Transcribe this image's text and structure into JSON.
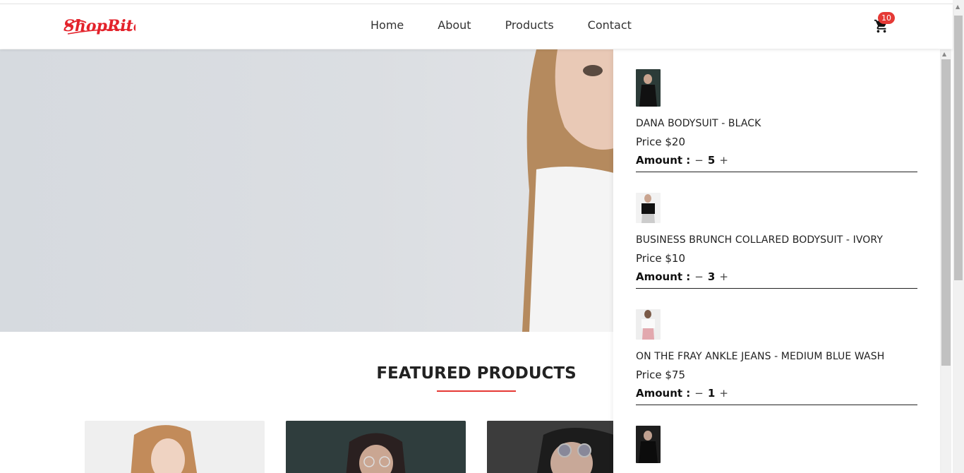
{
  "brand": {
    "name": "ShopRite",
    "accent": "#e3222b"
  },
  "nav": {
    "links": [
      "Home",
      "About",
      "Products",
      "Contact"
    ]
  },
  "cart": {
    "icon": "shopping-cart-icon",
    "count": "10",
    "items": [
      {
        "name": "DANA BODYSUIT - BLACK",
        "price": "Price $20",
        "amount_label": "Amount :",
        "qty": "5"
      },
      {
        "name": "BUSINESS BRUNCH COLLARED BODYSUIT - IVORY",
        "price": "Price $10",
        "amount_label": "Amount :",
        "qty": "3"
      },
      {
        "name": "ON THE FRAY ANKLE JEANS - MEDIUM BLUE WASH",
        "price": "Price $75",
        "amount_label": "Amount :",
        "qty": "1"
      }
    ],
    "decrement": "−",
    "increment": "+"
  },
  "featured": {
    "title": "FEATURED PRODUCTS",
    "underline_color": "#e53935"
  }
}
